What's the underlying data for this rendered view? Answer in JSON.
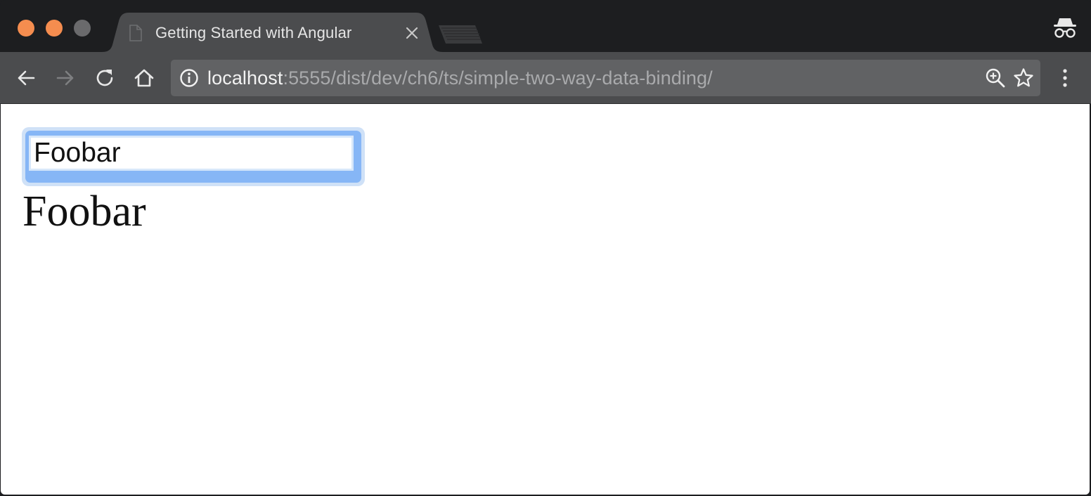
{
  "browser": {
    "tab": {
      "title": "Getting Started with Angular"
    },
    "address_bar": {
      "host": "localhost",
      "path": ":5555/dist/dev/ch6/ts/simple-two-way-data-binding/"
    },
    "icons": {
      "traffic_lights": [
        "close",
        "minimize",
        "maximize"
      ],
      "tab": [
        "page-icon",
        "close-icon"
      ],
      "toolbar": [
        "back-arrow-icon",
        "forward-arrow-icon",
        "reload-icon",
        "home-icon",
        "info-icon",
        "zoom-icon",
        "star-icon",
        "menu-dots-icon"
      ],
      "profile": "incognito-icon"
    },
    "colors": {
      "traffic_light_active": "#f58d4f",
      "traffic_light_inactive": "#6a6a6c",
      "focus_ring": "#86b6f6"
    }
  },
  "page": {
    "input_value": "Foobar",
    "bound_text": "Foobar"
  }
}
